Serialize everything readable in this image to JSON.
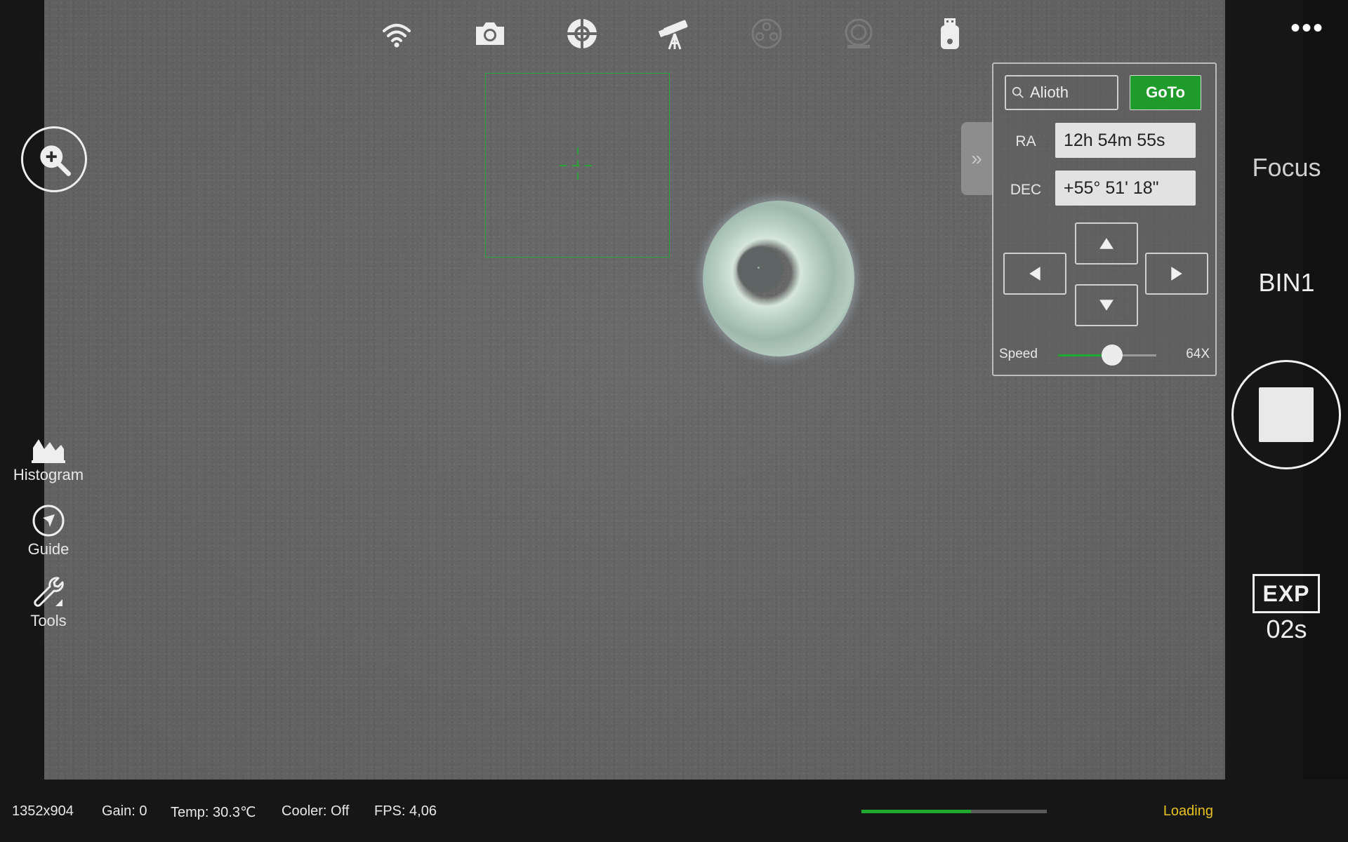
{
  "mount": {
    "search_value": "Alioth",
    "goto_label": "GoTo",
    "ra_label": "RA",
    "ra_value": "12h 54m 55s",
    "dec_label": "DEC",
    "dec_value": "+55° 51' 18\"",
    "speed_label": "Speed",
    "speed_value": "64X",
    "speed_fraction": 0.55,
    "collapse_glyph": "»"
  },
  "top_icons": [
    "wifi-icon",
    "camera-icon",
    "crosshair-target-icon",
    "telescope-mount-icon",
    "filter-wheel-icon",
    "focuser-icon",
    "usb-drive-icon"
  ],
  "left_tools": {
    "histogram_label": "Histogram",
    "guide_label": "Guide",
    "tools_label": "Tools"
  },
  "right_panel": {
    "more_glyph": "•••",
    "focus_label": "Focus",
    "bin_label": "BIN1",
    "exp_label": "EXP",
    "exp_value": "02s"
  },
  "status": {
    "resolution": "1352x904",
    "gain": "Gain: 0",
    "temp": "Temp: 30.3℃",
    "cooler": "Cooler: Off",
    "fps": "FPS: 4,06",
    "progress_fraction": 0.59,
    "loading_text": "Loading"
  },
  "colors": {
    "accent_green": "#1e9b2a",
    "loading_yellow": "#e7c21e"
  }
}
